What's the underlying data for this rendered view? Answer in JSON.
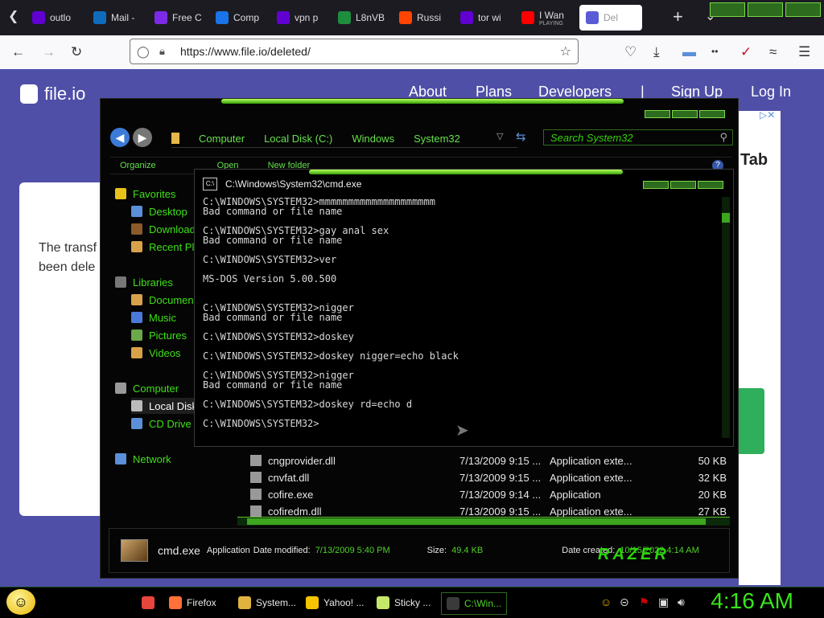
{
  "browser": {
    "tabs": [
      {
        "label": "outlo",
        "icon": "yahoo-icon",
        "color": "#6001d2"
      },
      {
        "label": "Mail -",
        "icon": "outlook-icon",
        "color": "#0f6cbd"
      },
      {
        "label": "Free C",
        "icon": "canva-icon",
        "color": "#7d2ae8"
      },
      {
        "label": "Comp",
        "icon": "maps-icon",
        "color": "#1a73e8"
      },
      {
        "label": "vpn p",
        "icon": "yahoo-icon",
        "color": "#6001d2"
      },
      {
        "label": "L8nVB",
        "icon": "translate-icon",
        "color": "#1e8e3e"
      },
      {
        "label": "Russi",
        "icon": "reddit-icon",
        "color": "#ff4500"
      },
      {
        "label": "tor wi",
        "icon": "yahoo-icon",
        "color": "#6001d2"
      },
      {
        "label": "I Wan",
        "sub": "PLAYING",
        "icon": "youtube-icon",
        "color": "#ff0000"
      },
      {
        "label": "Del",
        "icon": "fileio-icon",
        "color": "#5b5bd6",
        "active": true
      }
    ],
    "url": "https://www.file.io/deleted/"
  },
  "page": {
    "logo": "file.io",
    "nav": [
      "About",
      "Plans",
      "Developers",
      "|",
      "Sign Up",
      "Log In"
    ],
    "card_text_1": "The transf",
    "card_text_2": "been dele",
    "right_word": "Tab"
  },
  "explorer": {
    "breadcrumb": [
      "Computer",
      "Local Disk (C:)",
      "Windows",
      "System32"
    ],
    "search_placeholder": "Search System32",
    "toolbar": [
      "Organize",
      "Open",
      "New folder"
    ],
    "sidebar": [
      {
        "label": "Favorites",
        "icon": "star-icon",
        "indent": 0
      },
      {
        "label": "Desktop",
        "icon": "desktop-icon",
        "indent": 1
      },
      {
        "label": "Download",
        "icon": "downloads-icon",
        "indent": 1
      },
      {
        "label": "Recent Pl",
        "icon": "recent-places-icon",
        "indent": 1
      },
      {
        "label": "Libraries",
        "icon": "libraries-icon",
        "indent": 0
      },
      {
        "label": "Document",
        "icon": "documents-icon",
        "indent": 1
      },
      {
        "label": "Music",
        "icon": "music-icon",
        "indent": 1
      },
      {
        "label": "Pictures",
        "icon": "pictures-icon",
        "indent": 1
      },
      {
        "label": "Videos",
        "icon": "videos-icon",
        "indent": 1
      },
      {
        "label": "Computer",
        "icon": "computer-icon",
        "indent": 0
      },
      {
        "label": "Local Disk",
        "icon": "hard-drive-icon",
        "indent": 1,
        "selected": true
      },
      {
        "label": "CD Drive (",
        "icon": "cd-drive-icon",
        "indent": 1
      },
      {
        "label": "Network",
        "icon": "network-icon",
        "indent": 0
      }
    ],
    "files": [
      {
        "name": "cngprovider.dll",
        "date": "7/13/2009 9:15 ...",
        "type": "Application exte...",
        "size": "50 KB"
      },
      {
        "name": "cnvfat.dll",
        "date": "7/13/2009 9:15 ...",
        "type": "Application exte...",
        "size": "32 KB"
      },
      {
        "name": "cofire.exe",
        "date": "7/13/2009 9:14 ...",
        "type": "Application",
        "size": "20 KB"
      },
      {
        "name": "cofiredm.dll",
        "date": "7/13/2009 9:15 ...",
        "type": "Application exte...",
        "size": "27 KB"
      }
    ],
    "details": {
      "name": "cmd.exe",
      "type_label": "Application",
      "modified_label": "Date modified:",
      "modified": "7/13/2009 5:40 PM",
      "size_label": "Size:",
      "size": "49.4 KB",
      "created_label": "Date created:",
      "created": "10/15/2022 4:14 AM",
      "brand": "RAZER"
    }
  },
  "cmd": {
    "title": "C:\\Windows\\System32\\cmd.exe",
    "output": "C:\\WINDOWS\\SYSTEM32>mmmmmmmmmmmmmmmmmmmm\nBad command or file name\n\nC:\\WINDOWS\\SYSTEM32>gay anal sex\nBad command or file name\n\nC:\\WINDOWS\\SYSTEM32>ver\n\nMS-DOS Version 5.00.500\n\n\nC:\\WINDOWS\\SYSTEM32>nigger\nBad command or file name\n\nC:\\WINDOWS\\SYSTEM32>doskey\n\nC:\\WINDOWS\\SYSTEM32>doskey nigger=echo black\n\nC:\\WINDOWS\\SYSTEM32>nigger\nBad command or file name\n\nC:\\WINDOWS\\SYSTEM32>doskey rd=echo d\n\nC:\\WINDOWS\\SYSTEM32>"
  },
  "taskbar": {
    "items": [
      {
        "label": "",
        "icon": "chrome-icon",
        "color": "#e8453c"
      },
      {
        "label": "Firefox",
        "icon": "firefox-icon",
        "color": "#ff7139"
      },
      {
        "label": "System...",
        "icon": "folder-icon",
        "color": "#e0b341"
      },
      {
        "label": "Yahoo! ...",
        "icon": "yahoo-messenger-icon",
        "color": "#f6c400"
      },
      {
        "label": "Sticky ...",
        "icon": "sticky-notes-icon",
        "color": "#c6e86a"
      },
      {
        "label": "C:\\Win...",
        "icon": "cmd-icon",
        "color": "#3a3a3a",
        "active": true
      }
    ],
    "clock": "4:16 AM"
  }
}
